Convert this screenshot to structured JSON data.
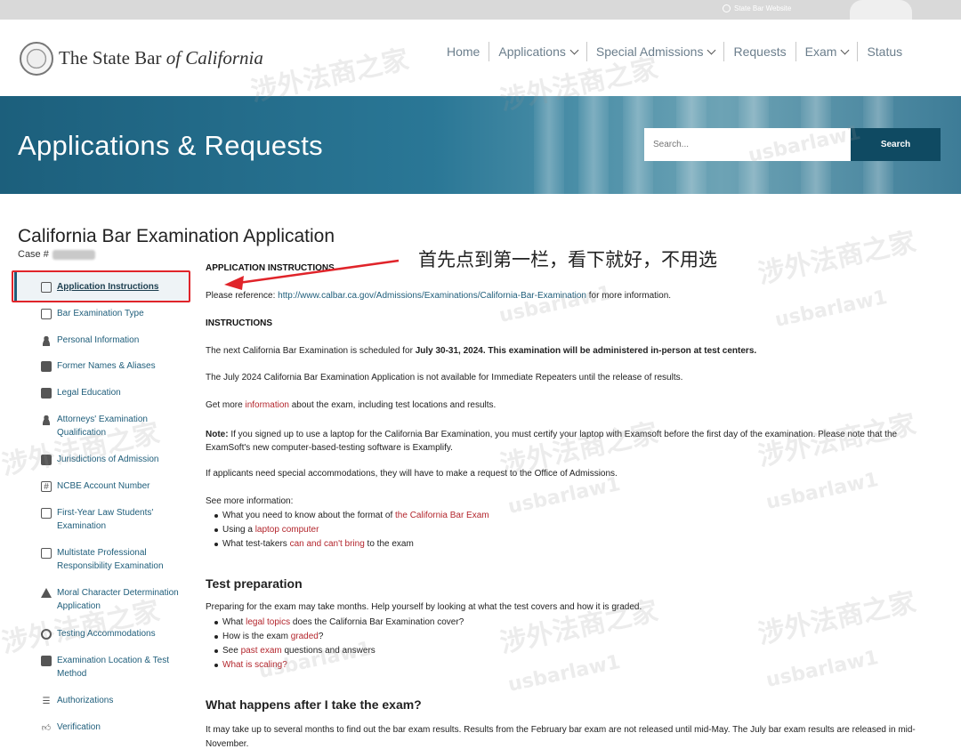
{
  "topbar": {
    "util_link": "State Bar Website"
  },
  "header": {
    "logo_main": "The State Bar ",
    "logo_italic": "of California",
    "nav": [
      {
        "label": "Home",
        "dropdown": false
      },
      {
        "label": "Applications",
        "dropdown": true
      },
      {
        "label": "Special Admissions",
        "dropdown": true
      },
      {
        "label": "Requests",
        "dropdown": false
      },
      {
        "label": "Exam",
        "dropdown": true
      },
      {
        "label": "Status",
        "dropdown": false
      }
    ]
  },
  "banner": {
    "title": "Applications & Requests",
    "search_placeholder": "Search...",
    "search_button": "Search"
  },
  "page": {
    "title": "California Bar Examination Application",
    "case_label": "Case #"
  },
  "sidebar": {
    "items": [
      {
        "label": "Application Instructions",
        "icon": "document-icon",
        "active": true
      },
      {
        "label": "Bar Examination Type",
        "icon": "id-card-icon"
      },
      {
        "label": "Personal Information",
        "icon": "person-icon"
      },
      {
        "label": "Former Names & Aliases",
        "icon": "contacts-icon"
      },
      {
        "label": "Legal Education",
        "icon": "briefcase-icon"
      },
      {
        "label": "Attorneys' Examination Qualification",
        "icon": "user-key-icon"
      },
      {
        "label": "Jurisdictions of Admission",
        "icon": "graduation-cap-icon"
      },
      {
        "label": "NCBE Account Number",
        "icon": "hash-icon"
      },
      {
        "label": "First-Year Law Students' Examination",
        "icon": "edit-document-icon"
      },
      {
        "label": "Multistate Professional Responsibility Examination",
        "icon": "edit-document-icon"
      },
      {
        "label": "Moral Character Determination Application",
        "icon": "warning-icon"
      },
      {
        "label": "Testing Accommodations",
        "icon": "lifebuoy-icon"
      },
      {
        "label": "Examination Location & Test Method",
        "icon": "location-icon"
      },
      {
        "label": "Authorizations",
        "icon": "checklist-icon"
      },
      {
        "label": "Verification",
        "icon": "thumbs-up-icon"
      }
    ]
  },
  "main": {
    "app_instructions_heading": "APPLICATION INSTRUCTIONS",
    "ref_prefix": "Please reference: ",
    "ref_url": "http://www.calbar.ca.gov/Admissions/Examinations/California-Bar-Examination",
    "ref_suffix": " for more information.",
    "instructions_heading": "INSTRUCTIONS",
    "p1_prefix": "The next California Bar Examination is scheduled for ",
    "p1_bold": "July 30-31, 2024. This examination will be administered in-person at test centers.",
    "p2": "The July 2024 California Bar Examination Application is not available for Immediate Repeaters until the release of results.",
    "p3_prefix": "Get more ",
    "p3_link": "information",
    "p3_suffix": " about the exam, including test locations and results.",
    "note_label": "Note:",
    "note_text": " If you signed up to use a laptop for the California Bar Examination, you must certify your laptop with Examsoft before the first day of the examination. Please note that the ExamSoft's new computer-based-testing software is Examplify.",
    "p5": "If applicants need special accommodations, they will have to make a request to the Office of Admissions.",
    "see_more": "See more information:",
    "see_more_list": [
      {
        "pre": "What you need to know about the format of ",
        "link": "the California Bar Exam",
        "post": ""
      },
      {
        "pre": "Using a ",
        "link": "laptop computer",
        "post": ""
      },
      {
        "pre": "What test-takers ",
        "link": "can and can't bring",
        "post": " to the exam"
      }
    ],
    "test_prep_heading": "Test preparation",
    "test_prep_intro": "Preparing for the exam may take months. Help yourself by looking at what the test covers and how it is graded.",
    "test_prep_list": [
      {
        "pre": "What ",
        "link": "legal topics",
        "post": " does the California Bar Examination cover?"
      },
      {
        "pre": "How is the exam ",
        "link": "graded",
        "post": "?"
      },
      {
        "pre": "See ",
        "link": "past exam",
        "post": " questions and answers"
      },
      {
        "pre": "",
        "link": "What is scaling?",
        "post": ""
      }
    ],
    "after_heading": "What happens after I take the exam?",
    "after_text": "It may take up to several months to find out the bar exam results. Results from the February bar exam are not released until mid-May. The July bar exam results are released in mid-November."
  },
  "annotation": {
    "text": "首先点到第一栏，看下就好，不用选"
  },
  "watermarks": {
    "cn": "涉外法商之家",
    "en": "usbarlaw1"
  },
  "colors": {
    "annotation_red": "#e0242a",
    "link_red": "#b3262d",
    "link_blue": "#1e5d7a",
    "search_button": "#0f4a62"
  }
}
